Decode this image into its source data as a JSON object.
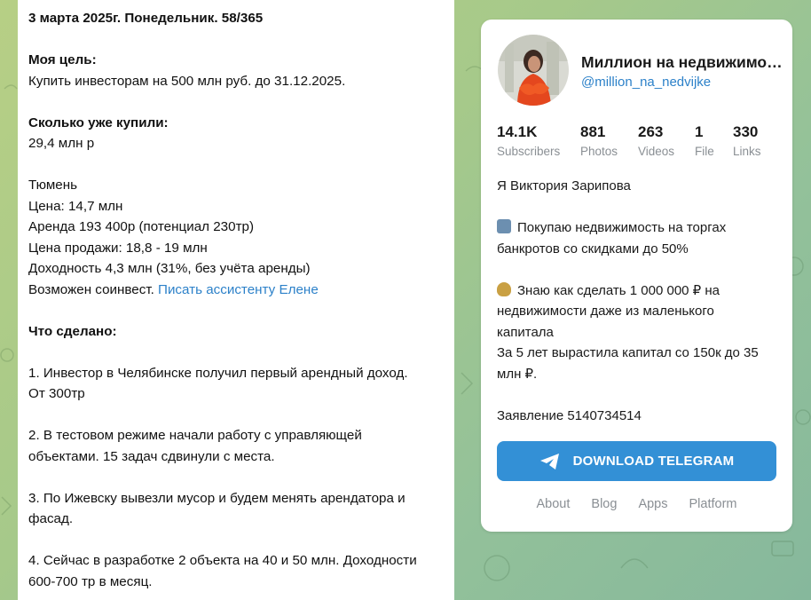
{
  "post": {
    "header": "3 марта 2025г. Понедельник. 58/365",
    "goal_title": "Моя цель:",
    "goal_text": "Купить инвесторам на 500 млн руб. до 31.12.2025.",
    "bought_title": "Сколько уже купили:",
    "bought_value": "29,4 млн р",
    "city": "Тюмень",
    "price": "Цена: 14,7 млн",
    "rent": "Аренда 193 400р (потенциал 230тр)",
    "sale_price": "Цена продажи: 18,8 - 19 млн",
    "yield": "Доходность 4,3 млн (31%, без учёта аренды)",
    "coinvest_prefix": "Возможен соинвест. ",
    "coinvest_link": "Писать ассистенту Елене",
    "done_title": "Что сделано:",
    "item1_line1": "1. Инвестор в Челябинске получил первый арендный доход.",
    "item1_line2": "От 300тр",
    "item2_line1": "2. В тестовом режиме начали работу с управляющей",
    "item2_line2": "объектами. 15 задач сдвинули с места.",
    "item3_line1": "3. По Ижевску вывезли мусор и будем менять арендатора и",
    "item3_line2": "фасад.",
    "item4_line1": "4. Сейчас в разработке 2 объекта на 40 и 50 млн. Доходности",
    "item4_line2": "600-700 тр в месяц."
  },
  "channel": {
    "title": "Миллион на недвижимо…",
    "handle": "@million_na_nedvijke",
    "stats": [
      {
        "num": "14.1K",
        "label": "Subscribers"
      },
      {
        "num": "881",
        "label": "Photos"
      },
      {
        "num": "263",
        "label": "Videos"
      },
      {
        "num": "1",
        "label": "File"
      },
      {
        "num": "330",
        "label": "Links"
      }
    ],
    "desc_name": "Я Виктория Зарипова",
    "desc_buy_line1": "Покупаю недвижимость на торгах",
    "desc_buy_line2": "банкротов со скидками до 50%",
    "desc_know_line1": "Знаю как сделать 1 000 000 ₽ на",
    "desc_know_line2": "недвижимости даже из маленького",
    "desc_know_line3": "капитала",
    "desc_grew_line1": "За 5 лет вырастила капитал со 150к до 35",
    "desc_grew_line2": "млн ₽.",
    "statement": "Заявление 5140734514",
    "emoji_building": "building-emoji-icon",
    "emoji_money": "money-bag-emoji-icon",
    "download_label": "DOWNLOAD TELEGRAM",
    "footer": [
      "About",
      "Blog",
      "Apps",
      "Platform"
    ]
  },
  "colors": {
    "accent": "#3390d6",
    "link": "#2c81c9",
    "muted": "#8a8f94"
  }
}
